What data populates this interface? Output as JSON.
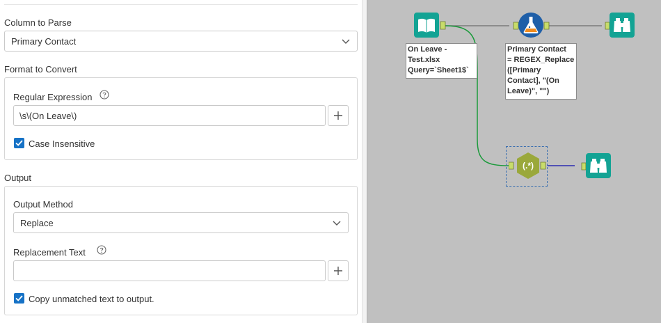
{
  "config": {
    "column_to_parse": {
      "label": "Column to Parse",
      "selected": "Primary Contact"
    },
    "format_to_convert": {
      "label": "Format to Convert",
      "regex_label": "Regular Expression",
      "regex_value": "\\s\\(On Leave\\)",
      "case_insensitive": {
        "label": "Case Insensitive",
        "checked": true
      }
    },
    "output": {
      "label": "Output",
      "method_label": "Output Method",
      "method_selected": "Replace",
      "replacement_label": "Replacement Text",
      "replacement_value": "",
      "copy_unmatched": {
        "label": "Copy unmatched text to output.",
        "checked": true
      }
    }
  },
  "canvas": {
    "tools": [
      {
        "id": "input",
        "icon": "book-input-icon",
        "color": "#13a394"
      },
      {
        "id": "formula",
        "icon": "flask-formula-icon",
        "color": "#1f5fa8"
      },
      {
        "id": "browse-top",
        "icon": "binoculars-browse-icon",
        "color": "#13a394"
      },
      {
        "id": "regex",
        "icon": "regex-hexagon-icon",
        "color": "#9aa83b"
      },
      {
        "id": "browse-bottom",
        "icon": "binoculars-browse-icon",
        "color": "#13a394"
      }
    ],
    "annotations": {
      "input": "On Leave -\nTest.xlsx\nQuery=`Sheet1$`",
      "formula": "Primary Contact\n= REGEX_Replace\n([Primary\nContact], \"(On\nLeave)\", \"\")"
    },
    "regex_glyph": "(.*)",
    "colors": {
      "canvas_bg": "#c0c0c0",
      "wire_green": "#1a9a3a",
      "wire_gray": "#7a7a7a",
      "wire_blue": "#2a2ab0",
      "anchor": "#c8dc6a",
      "checkbox": "#1672c6"
    }
  }
}
